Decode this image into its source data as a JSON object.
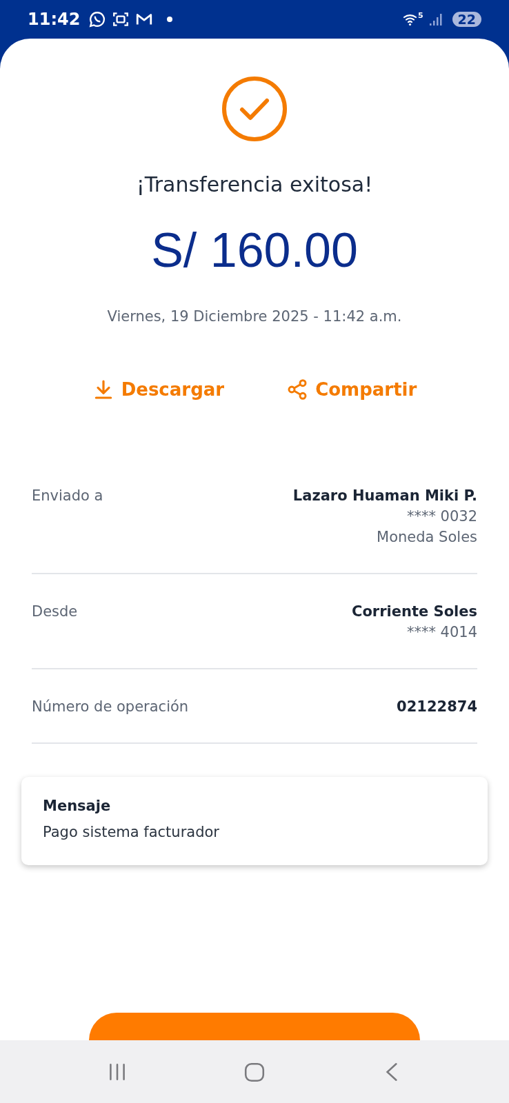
{
  "status_bar": {
    "time": "11:42",
    "wifi_badge": "5",
    "battery": "22"
  },
  "result": {
    "title": "¡Transferencia exitosa!",
    "amount": "S/ 160.00",
    "date": "Viernes, 19 Diciembre 2025 - 11:42 a.m."
  },
  "actions": [
    {
      "kind": "download",
      "label": "Descargar"
    },
    {
      "kind": "share",
      "label": "Compartir"
    }
  ],
  "details": [
    {
      "label": "Enviado a",
      "values": [
        {
          "text": "Lazaro Huaman Miki P.",
          "emphasis": true
        },
        {
          "text": "**** 0032",
          "emphasis": false
        },
        {
          "text": "Moneda Soles",
          "emphasis": false
        }
      ]
    },
    {
      "label": "Desde",
      "values": [
        {
          "text": "Corriente Soles",
          "emphasis": true
        },
        {
          "text": "**** 4014",
          "emphasis": false
        }
      ]
    },
    {
      "label": "Número de operación",
      "values": [
        {
          "text": "02122874",
          "emphasis": true
        }
      ]
    }
  ],
  "message": {
    "title": "Mensaje",
    "text": "Pago sistema facturador"
  }
}
